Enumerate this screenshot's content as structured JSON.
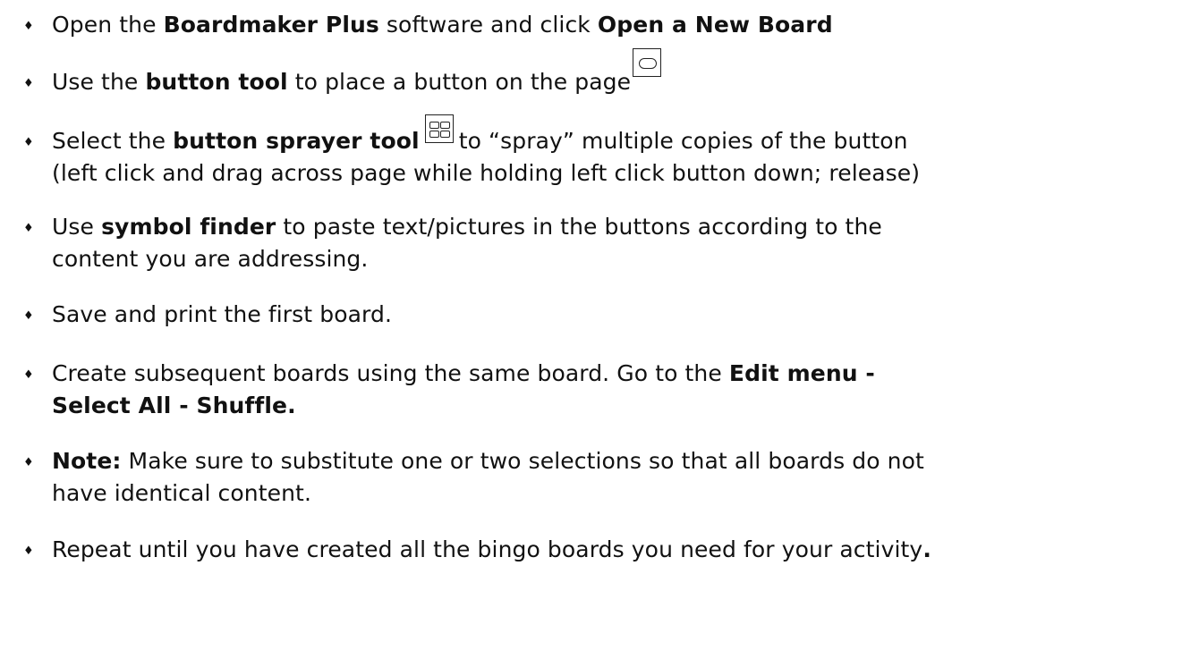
{
  "steps": [
    {
      "a": "Open the ",
      "b1": "Boardmaker Plus",
      "c": " software and click ",
      "b2": "Open a New Board"
    },
    {
      "a": "Use the ",
      "b1": "button tool",
      "c": " to place a button on the page",
      "icon": "button-tool-icon"
    },
    {
      "a": "Select  the ",
      "b1": "button sprayer tool",
      "c": "to “spray” multiple copies of the button",
      "line2": "(left click and drag across page while holding left click button down; release)",
      "icon": "button-sprayer-tool-icon"
    },
    {
      "a": "Use ",
      "b1": "symbol finder",
      "c": " to paste text/pictures in the buttons according to the",
      "line2": "content you are addressing."
    },
    {
      "a": "Save and print the first board."
    },
    {
      "a": "Create subsequent boards using the same board. Go to the ",
      "b1": "Edit menu  -",
      "line2b": "Select All - Shuffle."
    },
    {
      "b1": "Note:",
      "c": " Make sure to substitute  one or two selections so that all boards do not",
      "line2": "have identical content."
    },
    {
      "a": "Repeat until you have created all the bingo boards you need for your activity",
      "b1": "."
    }
  ],
  "bullet_glyph": "♦"
}
